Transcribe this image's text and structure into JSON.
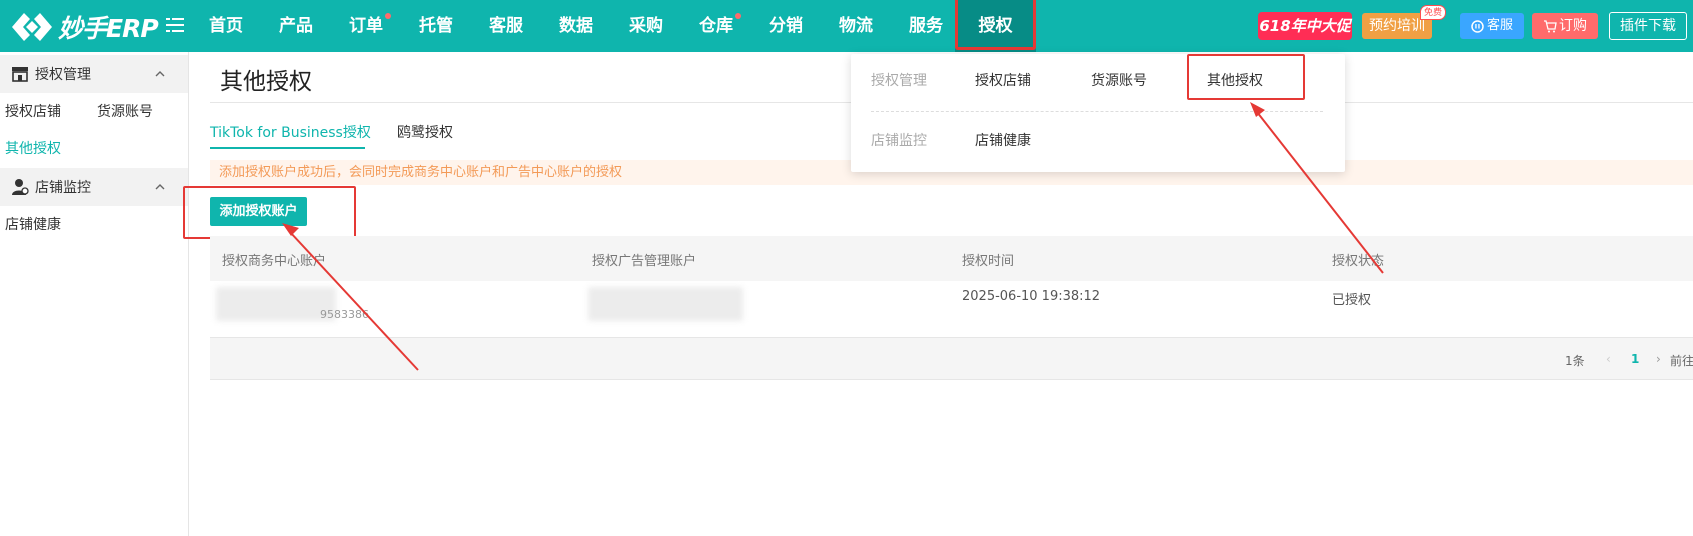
{
  "app": {
    "logo_text": "妙手ERP"
  },
  "nav": {
    "items": [
      {
        "label": "首页"
      },
      {
        "label": "产品"
      },
      {
        "label": "订单",
        "dot": true
      },
      {
        "label": "托管"
      },
      {
        "label": "客服"
      },
      {
        "label": "数据"
      },
      {
        "label": "采购"
      },
      {
        "label": "仓库",
        "dot": true
      },
      {
        "label": "分销"
      },
      {
        "label": "物流"
      },
      {
        "label": "服务"
      },
      {
        "label": "授权",
        "active": true
      }
    ],
    "promo_label": "618年中大促",
    "training_label": "预约培训",
    "free_badge": "免费",
    "service_label": "客服",
    "order_label": "订购",
    "plugin_label": "插件下载",
    "accent_color": "#0fb5ad",
    "highlight_color": "#e53935"
  },
  "sidebar": {
    "groups": [
      {
        "label": "授权管理",
        "icon": "store-icon",
        "items": [
          "授权店铺",
          "货源账号",
          "其他授权"
        ],
        "active_item": "其他授权"
      },
      {
        "label": "店铺监控",
        "icon": "user-monitor-icon",
        "items": [
          "店铺健康"
        ]
      }
    ]
  },
  "main": {
    "title": "其他授权",
    "tabs": [
      {
        "label": "TikTok for Business授权",
        "active": true
      },
      {
        "label": "鸥鹭授权"
      }
    ],
    "notice": "添加授权账户成功后，会同时完成商务中心账户和广告中心账户的授权",
    "add_button": "添加授权账户",
    "table": {
      "columns": [
        "授权商务中心账户",
        "授权广告管理账户",
        "授权时间",
        "授权状态"
      ],
      "rows": [
        {
          "business_account": "",
          "business_account_partial": "9583386",
          "ad_account": "",
          "time": "2025-06-10 19:38:12",
          "status": "已授权"
        }
      ]
    },
    "pagination": {
      "total": "1条",
      "current": "1",
      "goto_label": "前往"
    }
  },
  "dropdown": {
    "rows": [
      {
        "label": "授权管理",
        "items": [
          "授权店铺",
          "货源账号",
          "其他授权"
        ]
      },
      {
        "label": "店铺监控",
        "items": [
          "店铺健康"
        ]
      }
    ]
  }
}
